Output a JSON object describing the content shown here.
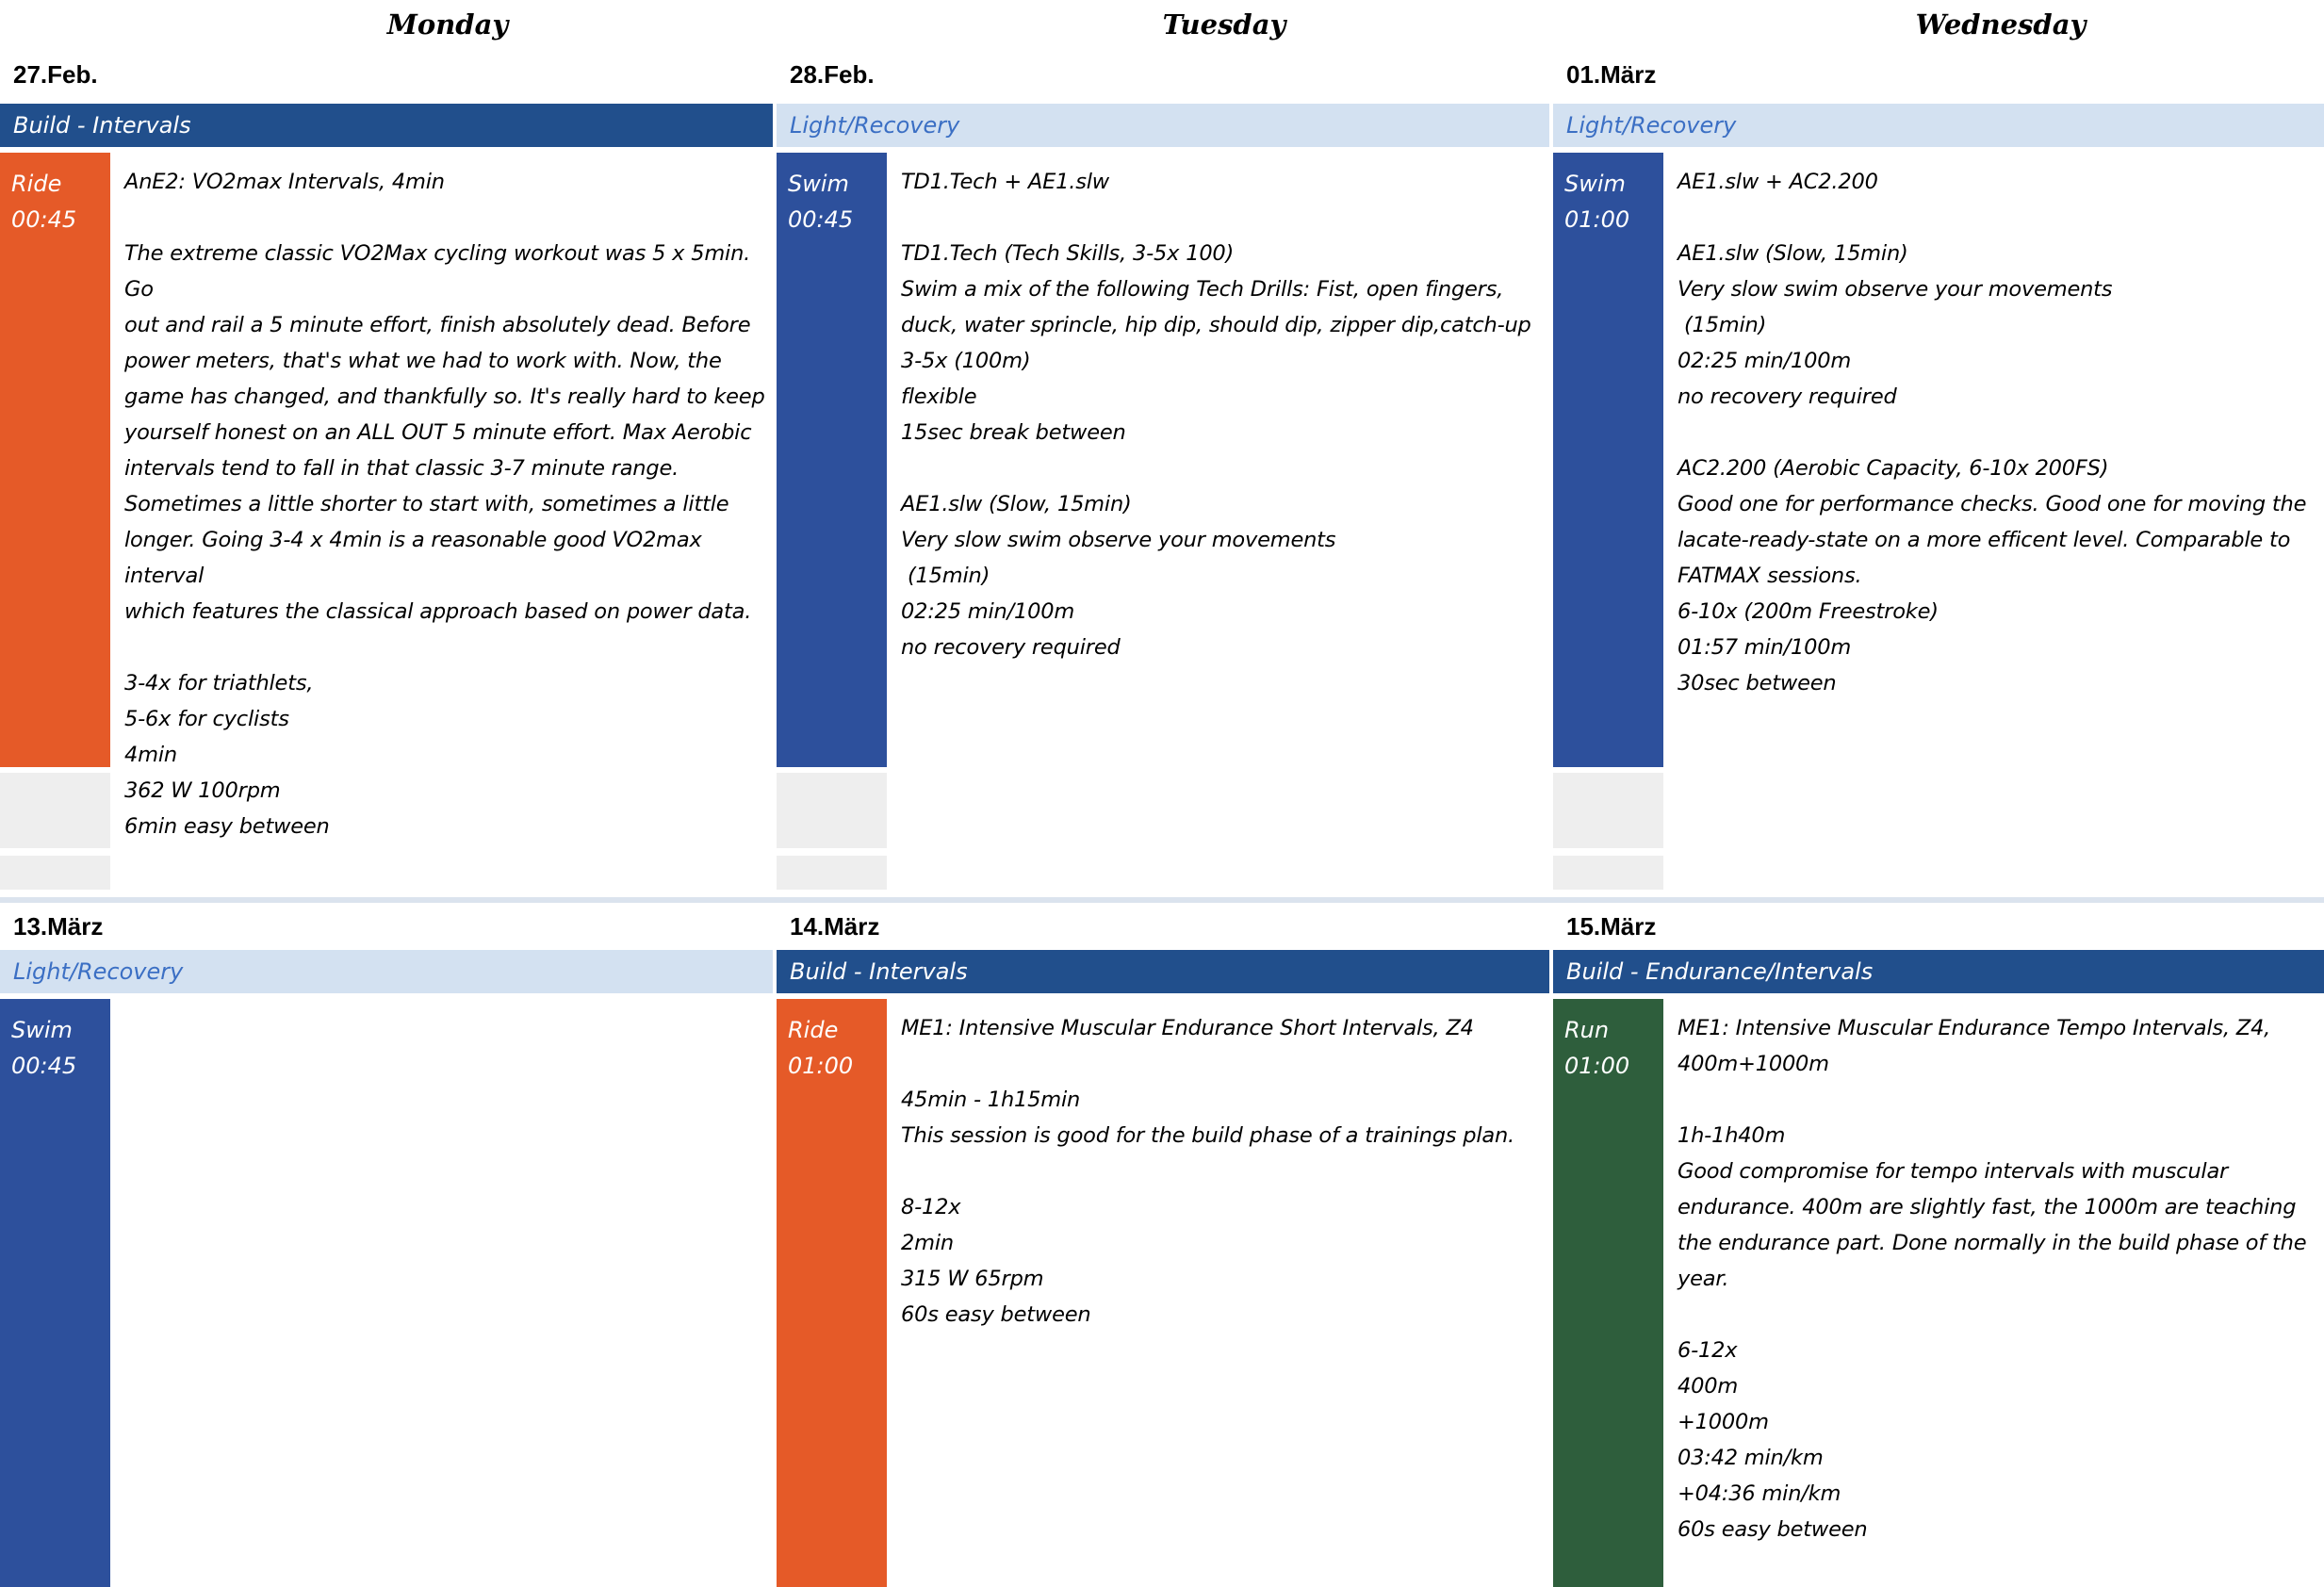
{
  "days": [
    "Monday",
    "Tuesday",
    "Wednesday"
  ],
  "cells": [
    {
      "date": "27.Feb.",
      "phase": "Build - Intervals",
      "sport": "Ride",
      "duration": "00:45",
      "text": "AnE2: VO2max Intervals, 4min\n\nThe extreme classic VO2Max cycling workout was 5 x 5min. Go\nout and rail a 5 minute effort, finish absolutely dead. Before\npower meters, that's what we had to work with. Now, the\ngame has changed, and thankfully so. It's really hard to keep\nyourself honest on an ALL OUT 5 minute effort. Max Aerobic\nintervals tend to fall in that classic 3-7 minute range.\nSometimes a little shorter to start with, sometimes a little\nlonger. Going 3-4 x 4min is a reasonable good VO2max interval\nwhich features the classical approach based on power data.\n\n3-4x for triathlets,\n5-6x for cyclists\n4min\n362 W 100rpm\n6min easy between"
    },
    {
      "date": "28.Feb.",
      "phase": "Light/Recovery",
      "sport": "Swim",
      "duration": "00:45",
      "text": "TD1.Tech + AE1.slw\n\nTD1.Tech (Tech Skills, 3-5x 100)\nSwim a mix of the following Tech Drills: Fist, open fingers,\nduck, water sprincle, hip dip, should dip, zipper dip,catch-up\n3-5x (100m)\nflexible\n15sec break between\n\nAE1.slw (Slow, 15min)\nVery slow swim observe your movements\n (15min)\n02:25 min/100m\nno recovery required"
    },
    {
      "date": "01.März",
      "phase": "Light/Recovery",
      "sport": "Swim",
      "duration": "01:00",
      "text": "AE1.slw + AC2.200\n\nAE1.slw (Slow, 15min)\nVery slow swim observe your movements\n (15min)\n02:25 min/100m\nno recovery required\n\nAC2.200 (Aerobic Capacity, 6-10x 200FS)\nGood one for performance checks. Good one for moving the\nlacate-ready-state on a more efficent level. Comparable to\nFATMAX sessions.\n6-10x (200m Freestroke)\n01:57 min/100m\n30sec between"
    },
    {
      "date": "13.März",
      "phase": "Light/Recovery",
      "sport": "Swim",
      "duration": "00:45",
      "text": ""
    },
    {
      "date": "14.März",
      "phase": "Build - Intervals",
      "sport": "Ride",
      "duration": "01:00",
      "text": "ME1: Intensive Muscular Endurance Short Intervals, Z4\n\n45min - 1h15min\nThis session is good for the build phase of a trainings plan.\n\n8-12x\n2min\n315 W 65rpm\n60s easy between"
    },
    {
      "date": "15.März",
      "phase": "Build - Endurance/Intervals",
      "sport": "Run",
      "duration": "01:00",
      "text": "ME1: Intensive Muscular Endurance Tempo Intervals, Z4,\n400m+1000m\n\n1h-1h40m\nGood compromise for tempo intervals with muscular\nendurance. 400m are slightly fast, the 1000m are teaching\nthe endurance part. Done normally in the build phase of the\nyear.\n\n6-12x\n400m\n+1000m\n03:42 min/km\n+04:36 min/km\n60s easy between"
    }
  ]
}
